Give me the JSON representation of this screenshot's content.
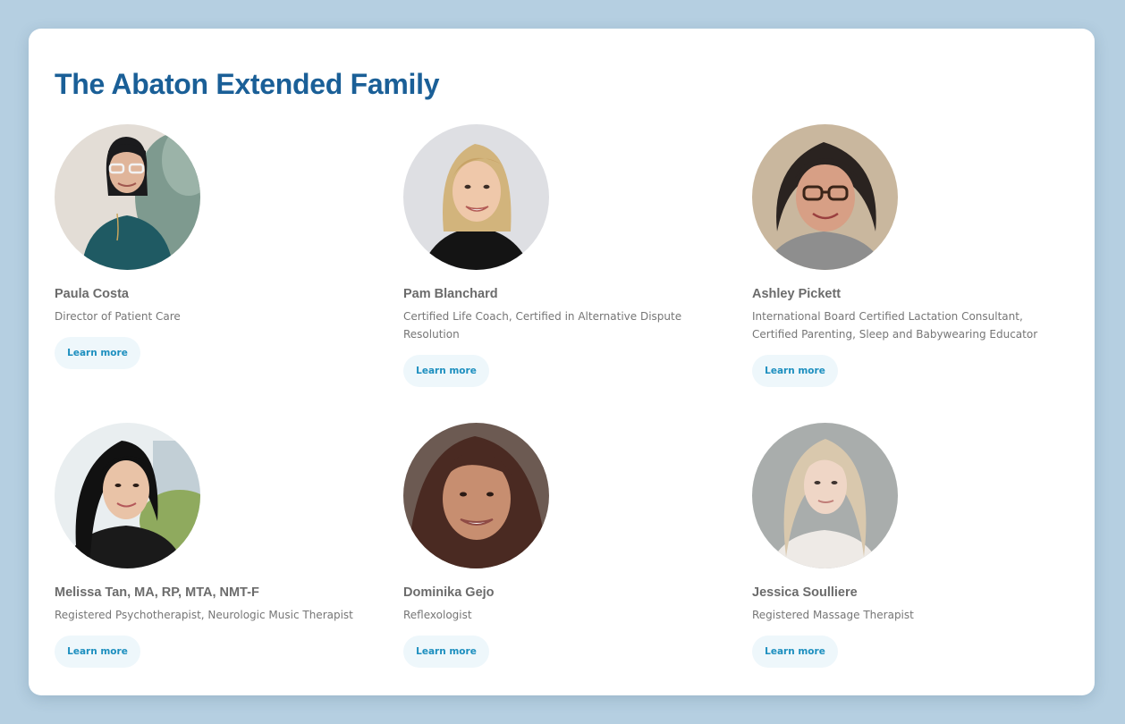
{
  "page": {
    "title": "The Abaton Extended Family"
  },
  "team": [
    {
      "name": "Paula Costa",
      "role": "Director of Patient Care",
      "button": "Learn more",
      "photo": "Paula Costa photo"
    },
    {
      "name": "Pam Blanchard",
      "role": "Certified Life Coach, Certified in Alternative Dispute Resolution",
      "button": "Learn more",
      "photo": "Pam Blanchard photo"
    },
    {
      "name": "Ashley Pickett",
      "role": "International Board Certified Lactation Consultant, Certified Parenting, Sleep and Babywearing Educator",
      "button": "Learn more",
      "photo": "Ashley Pickett photo"
    },
    {
      "name": "Melissa Tan, MA, RP, MTA, NMT-F",
      "role": "Registered Psychotherapist, Neurologic Music Therapist",
      "button": "Learn more",
      "photo": "Melissa Tan photo"
    },
    {
      "name": "Dominika Gejo",
      "role": "Reflexologist",
      "button": "Learn more",
      "photo": "Dominika Gejo photo"
    },
    {
      "name": "Jessica Soulliere",
      "role": "Registered Massage Therapist",
      "button": "Learn more",
      "photo": "Jessica Soulliere photo"
    }
  ],
  "colors": {
    "page_background": "#b5cfe1",
    "card_background": "#ffffff",
    "title": "#1a5f97",
    "name": "#6b6b6b",
    "role": "#767676",
    "button_background": "#eef7fb",
    "button_text": "#1d8fbf"
  }
}
